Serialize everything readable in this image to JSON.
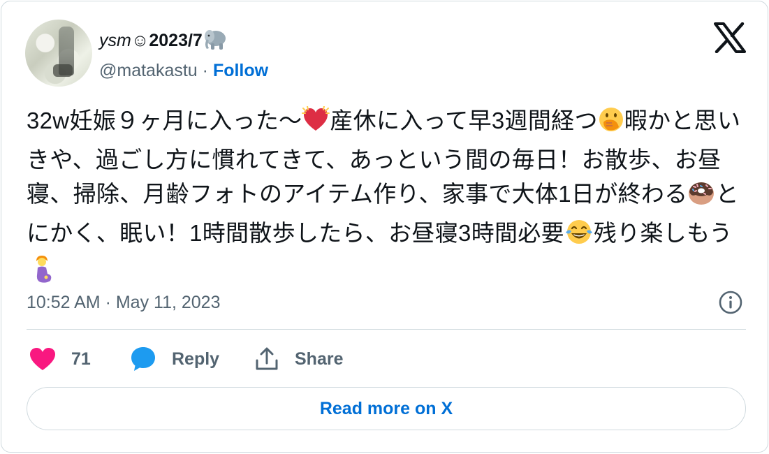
{
  "author": {
    "name_ysm": "ysm",
    "name_smile": "☺",
    "name_rest": "2023/7",
    "name_icon": "elephant-icon",
    "handle": "@matakastu",
    "separator": " · ",
    "follow_label": "Follow"
  },
  "logo": "x-logo-icon",
  "tweet": {
    "seg1": "32w妊娠９ヶ月に入った〜",
    "emoji1": "beating-heart-icon",
    "seg2": "産休に入って早3週間経つ",
    "emoji2": "face-with-hand-over-mouth-icon",
    "seg3": "暇かと思いきや、過ごし方に慣れてきて、あっという間の毎日！お散歩、お昼寝、掃除、月齢フォトのアイテム作り、家事で大体1日が終わる",
    "emoji3": "doughnut-icon",
    "seg4": "とにかく、眠い！1時間散歩したら、お昼寝3時間必要",
    "emoji4": "face-with-tears-of-joy-icon",
    "seg5": "残り楽しもう",
    "emoji5": "pregnant-woman-icon"
  },
  "timestamp": "10:52 AM · May 11, 2023",
  "actions": {
    "like_count": "71",
    "reply_label": "Reply",
    "share_label": "Share"
  },
  "read_more_label": "Read more on X",
  "colors": {
    "like": "#f91880",
    "reply": "#1d9bf0",
    "link": "#006fd6",
    "muted": "#536471",
    "border": "#cfd9de"
  }
}
